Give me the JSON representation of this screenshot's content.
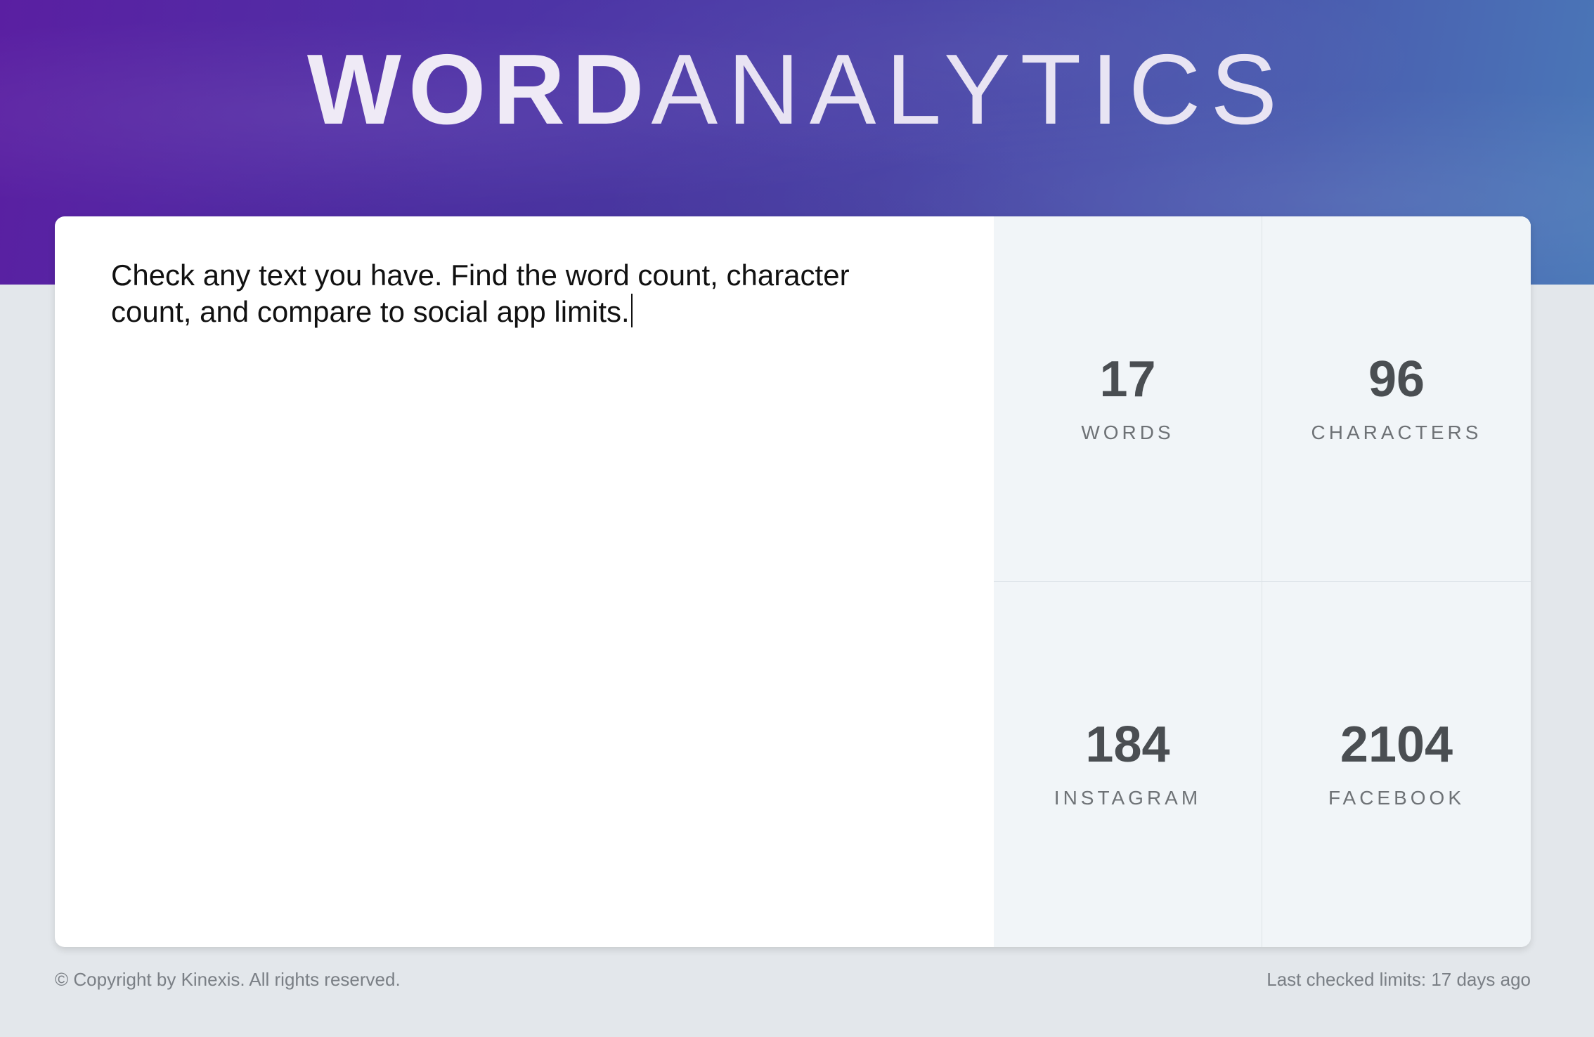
{
  "header": {
    "logo_bold": "WORD",
    "logo_light": "ANALYTICS"
  },
  "editor": {
    "text": "Check any text you have. Find the word count, character count, and compare to social app limits."
  },
  "stats": [
    {
      "value": "17",
      "label": "WORDS"
    },
    {
      "value": "96",
      "label": "CHARACTERS"
    },
    {
      "value": "184",
      "label": "INSTAGRAM"
    },
    {
      "value": "2104",
      "label": "FACEBOOK"
    }
  ],
  "footer": {
    "copyright": "© Copyright by Kinexis. All rights reserved.",
    "last_checked": "Last checked limits: 17 days ago"
  }
}
